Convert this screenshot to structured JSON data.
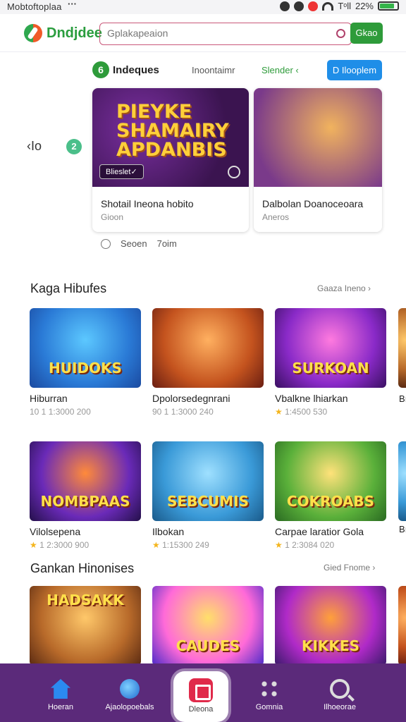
{
  "status": {
    "app_label": "Mobtoftoplaa",
    "dots": "···",
    "signal_text": "Tᵒll",
    "battery_pct": "22%",
    "battery_level": 0.85
  },
  "header": {
    "logo_text": "Dndjdee",
    "search_placeholder": "Gplakapeaion",
    "go_label": "Gkao"
  },
  "featured": {
    "badge": "6",
    "title": "Indeques",
    "link1": "Inoontaimr",
    "link2": "Slender ‹",
    "button": "D Ilooplem",
    "prev": "‹Io",
    "page_num": "2",
    "cards": [
      {
        "art_title": "PIEYKE SHAMAIRY APDANBIS",
        "pill": "Blieslet✓",
        "title": "Shotail Ineona hobito",
        "sub": "Gioon"
      },
      {
        "title": "Dalbolan Doanoceoara",
        "sub": "Aneros"
      }
    ],
    "pager_left": "Seoen",
    "pager_right": "7oim"
  },
  "section1": {
    "title": "Kaga Hibufes",
    "link": "Gaaza Ineno ›",
    "games": [
      {
        "art": "HUIDOKS",
        "name": "Hiburran",
        "meta": "10 1 1:3000 200",
        "star": false
      },
      {
        "art": "",
        "name": "Dpolorsedegnrani",
        "meta": "90 1 1:3000 240",
        "star": false
      },
      {
        "art": "SURKOAN",
        "name": "Vbalkne lhiarkan",
        "meta": "1:4500 530",
        "star": true
      }
    ],
    "edge_text": "Bı"
  },
  "section2": {
    "games": [
      {
        "art": "NOMBPAAS",
        "name": "Vilolsepena",
        "meta": "1 2:3000 900",
        "star": true
      },
      {
        "art": "SEBCUMIS",
        "name": "Ilbokan",
        "meta": "1:15300 249",
        "star": true
      },
      {
        "art": "COKROABS",
        "name": "Carpae laratior Gola",
        "meta": "1 2:3084 020",
        "star": true
      }
    ],
    "edge_text": "Bı"
  },
  "section3": {
    "title": "Gankan Hinonises",
    "link": "Gied Fnome ›",
    "games": [
      {
        "art": "HADSAKK",
        "name": ""
      },
      {
        "art": "CAUDES",
        "name": ""
      },
      {
        "art": "KIKKES",
        "name": ""
      }
    ]
  },
  "nav": {
    "items": [
      "Hoeran",
      "Ajaolopoebals",
      "Dleona",
      "Gomnia",
      "Ilhoeorae"
    ]
  },
  "colors": {
    "accent_green": "#2e9b3a",
    "accent_blue": "#1f8ee8",
    "nav_bg": "#5b2a7a",
    "star": "#f4b51c"
  }
}
